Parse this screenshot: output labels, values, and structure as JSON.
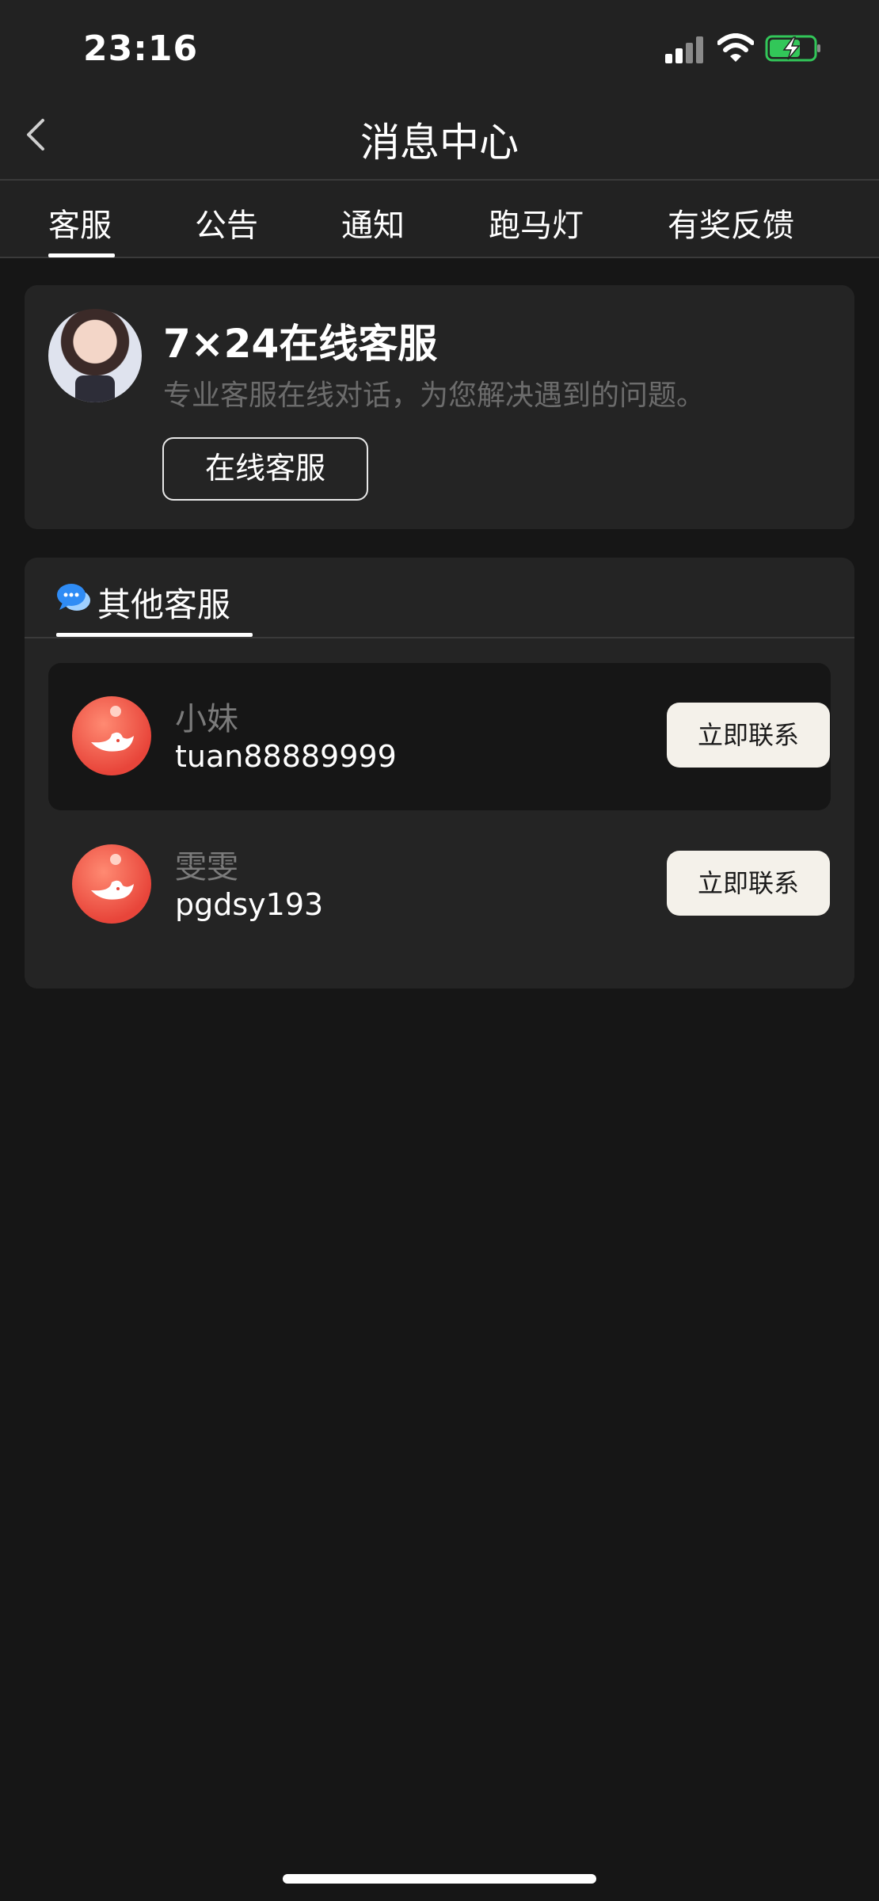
{
  "status_bar": {
    "time": "23:16",
    "icons": [
      "cellular-signal-icon",
      "wifi-icon",
      "battery-charging-icon"
    ]
  },
  "header": {
    "title": "消息中心",
    "back_icon": "chevron-left-icon"
  },
  "tabs": [
    {
      "label": "客服",
      "active": true
    },
    {
      "label": "公告",
      "active": false
    },
    {
      "label": "通知",
      "active": false
    },
    {
      "label": "跑马灯",
      "active": false
    },
    {
      "label": "有奖反馈",
      "active": false
    }
  ],
  "online_service": {
    "title": "7×24在线客服",
    "description": "专业客服在线对话，为您解决遇到的问题。",
    "button_label": "在线客服"
  },
  "other_service": {
    "title": "其他客服",
    "contacts": [
      {
        "name": "小妹",
        "account": "tuan88889999",
        "button_label": "立即联系",
        "highlighted": true
      },
      {
        "name": "雯雯",
        "account": "pgdsy193",
        "button_label": "立即联系",
        "highlighted": false
      }
    ]
  },
  "colors": {
    "background": "#161616",
    "card": "#242424",
    "bar": "#222222",
    "contact_button": "#f4f1ea",
    "avatar_red": "#e8453a",
    "battery_green": "#32c759"
  }
}
